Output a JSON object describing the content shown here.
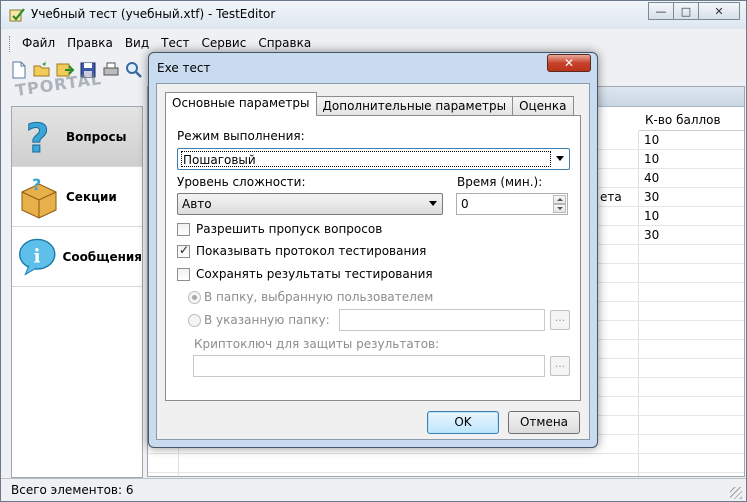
{
  "window": {
    "title": "Учебный тест (учебный.xtf) - TestEditor",
    "minimize_glyph": "—",
    "maximize_glyph": "□",
    "close_glyph": "✕"
  },
  "menu": [
    "Файл",
    "Правка",
    "Вид",
    "Тест",
    "Сервис",
    "Справка"
  ],
  "toolbar_icons": [
    "new-file-icon",
    "open-folder-icon",
    "export-icon",
    "save-icon",
    "print-icon",
    "search-icon"
  ],
  "watermark": "ТPORTAL",
  "left_nav": [
    {
      "label": "Вопросы",
      "icon": "question-icon",
      "selected": true
    },
    {
      "label": "Секции",
      "icon": "sections-box-icon",
      "selected": false
    },
    {
      "label": "Сообщения",
      "icon": "info-bubble-icon",
      "selected": false
    }
  ],
  "table": {
    "visible_header": "К-во баллов",
    "partial_text": "ета",
    "rows": [
      "10",
      "10",
      "40",
      "30",
      "10",
      "30"
    ]
  },
  "status": {
    "text": "Всего элементов: 6"
  },
  "dialog": {
    "title": "Exe тест",
    "close_glyph": "✕",
    "tabs": [
      "Основные параметры",
      "Дополнительные параметры",
      "Оценка"
    ],
    "mode_label": "Режим выполнения:",
    "mode_value": "Пошаговый",
    "difficulty_label": "Уровень сложности:",
    "difficulty_value": "Авто",
    "time_label": "Время (мин.):",
    "time_value": "0",
    "allow_skip": {
      "label": "Разрешить пропуск вопросов",
      "checked": false
    },
    "show_protocol": {
      "label": "Показывать протокол тестирования",
      "checked": true
    },
    "save_results": {
      "label": "Сохранять результаты тестирования",
      "checked": false
    },
    "radio_user_folder": {
      "label": "В папку, выбранную пользователем",
      "checked": true
    },
    "radio_specified_folder": {
      "label": "В указанную папку:",
      "checked": false
    },
    "browse_label": "...",
    "crypto_label": "Криптоключ для защиты результатов:",
    "ok_label": "OK",
    "cancel_label": "Отмена"
  }
}
